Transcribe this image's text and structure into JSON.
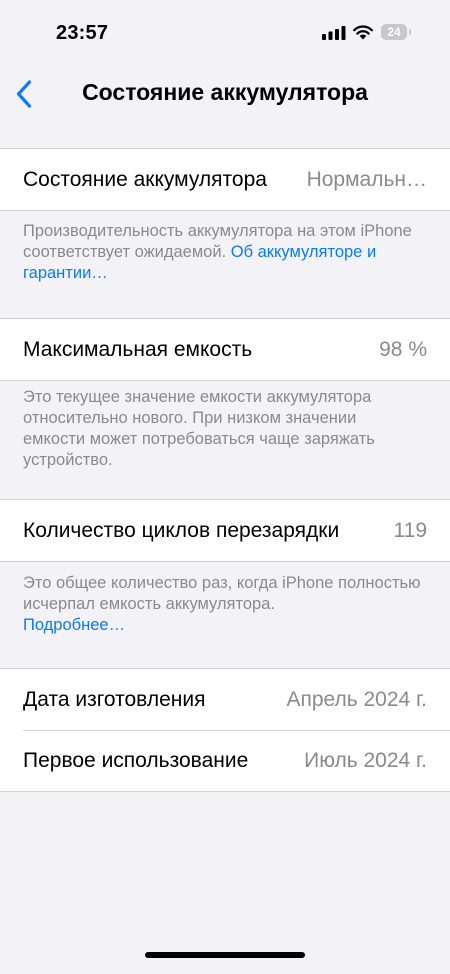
{
  "status_bar": {
    "time": "23:57",
    "battery_level": "24"
  },
  "nav": {
    "title": "Состояние аккумулятора"
  },
  "health": {
    "label": "Состояние аккумулятора",
    "value": "Нормальн…",
    "footer_text": "Производительность аккумулятора на этом iPhone соответствует ожидаемой. ",
    "footer_link": "Об аккумуля­торе и гарантии…"
  },
  "capacity": {
    "label": "Максимальная емкость",
    "value": "98 %",
    "footer_text": "Это текущее значение емкости аккумулятора относительно нового. При низком значении емкости может потребоваться чаще заряжать устройство."
  },
  "cycles": {
    "label": "Количество циклов перезарядки",
    "value": "119",
    "footer_text": "Это общее количество раз, когда iPhone полностью исчерпал емкость аккумулятора.",
    "footer_link": "Подробнее…"
  },
  "dates": {
    "manufacture_label": "Дата изготовления",
    "manufacture_value": "Апрель 2024 г.",
    "first_use_label": "Первое использование",
    "first_use_value": "Июль 2024 г."
  },
  "colors": {
    "accent": "#0a7aff",
    "background": "#f2f2f7",
    "secondary_text": "#8a8a8e"
  }
}
